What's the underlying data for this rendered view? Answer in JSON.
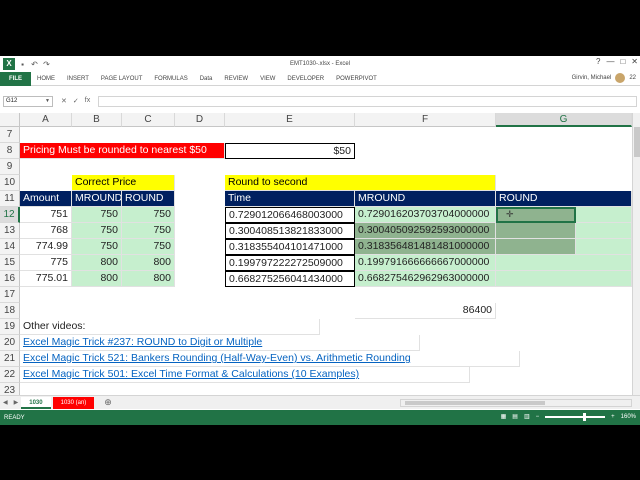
{
  "window": {
    "title": "EMT1030-.xlsx - Excel",
    "controls": [
      "?",
      "—",
      "□",
      "✕"
    ]
  },
  "ribbon": {
    "tabs": [
      "FILE",
      "HOME",
      "INSERT",
      "PAGE LAYOUT",
      "FORMULAS",
      "Data",
      "REVIEW",
      "VIEW",
      "DEVELOPER",
      "POWERPIVOT"
    ],
    "user": "Girvin, Michael",
    "user_badge": "22"
  },
  "formula_bar": {
    "name_box": "G12",
    "icons": [
      "✕",
      "✓",
      "fx"
    ],
    "value": ""
  },
  "columns": [
    "A",
    "B",
    "C",
    "D",
    "E",
    "F",
    "G"
  ],
  "rows": [
    "7",
    "8",
    "9",
    "10",
    "11",
    "12",
    "13",
    "14",
    "15",
    "16",
    "17",
    "18",
    "19",
    "20",
    "21",
    "22",
    "23"
  ],
  "cells": {
    "a8": "Pricing Must be rounded to nearest $50",
    "e8": "$50",
    "b10": "Correct Price",
    "e10": "Round to second",
    "a11": "Amount",
    "b11": "MROUND",
    "c11": "ROUND",
    "e11": "Time",
    "f11": "MROUND",
    "g11": "ROUND",
    "f18": "86400",
    "a19": "Other videos:",
    "a20": "Excel Magic Trick #237: ROUND to Digit or Multiple",
    "a21": "Excel Magic Trick 521: Bankers Rounding (Half-Way-Even) vs. Arithmetic Rounding",
    "a22": "Excel Magic Trick 501: Excel Time Format & Calculations (10 Examples)"
  },
  "table": [
    {
      "amount": "751",
      "mround": "750",
      "round": "750",
      "time": "0.729012066468003000",
      "time_mround": "0.729016203703704000000"
    },
    {
      "amount": "768",
      "mround": "750",
      "round": "750",
      "time": "0.300408513821833000",
      "time_mround": "0.300405092592593000000"
    },
    {
      "amount": "774.99",
      "mround": "750",
      "round": "750",
      "time": "0.318355404101471000",
      "time_mround": "0.318356481481481000000"
    },
    {
      "amount": "775",
      "mround": "800",
      "round": "800",
      "time": "0.199797222272509000",
      "time_mround": "0.199791666666667000000"
    },
    {
      "amount": "775.01",
      "mround": "800",
      "round": "800",
      "time": "0.668275256041434000",
      "time_mround": "0.668275462962963000000"
    }
  ],
  "sheets": {
    "tabs": [
      "1030",
      "1030 (an)"
    ],
    "active": "1030",
    "add": "⊕"
  },
  "status": {
    "ready": "READY",
    "zoom": "160%"
  }
}
